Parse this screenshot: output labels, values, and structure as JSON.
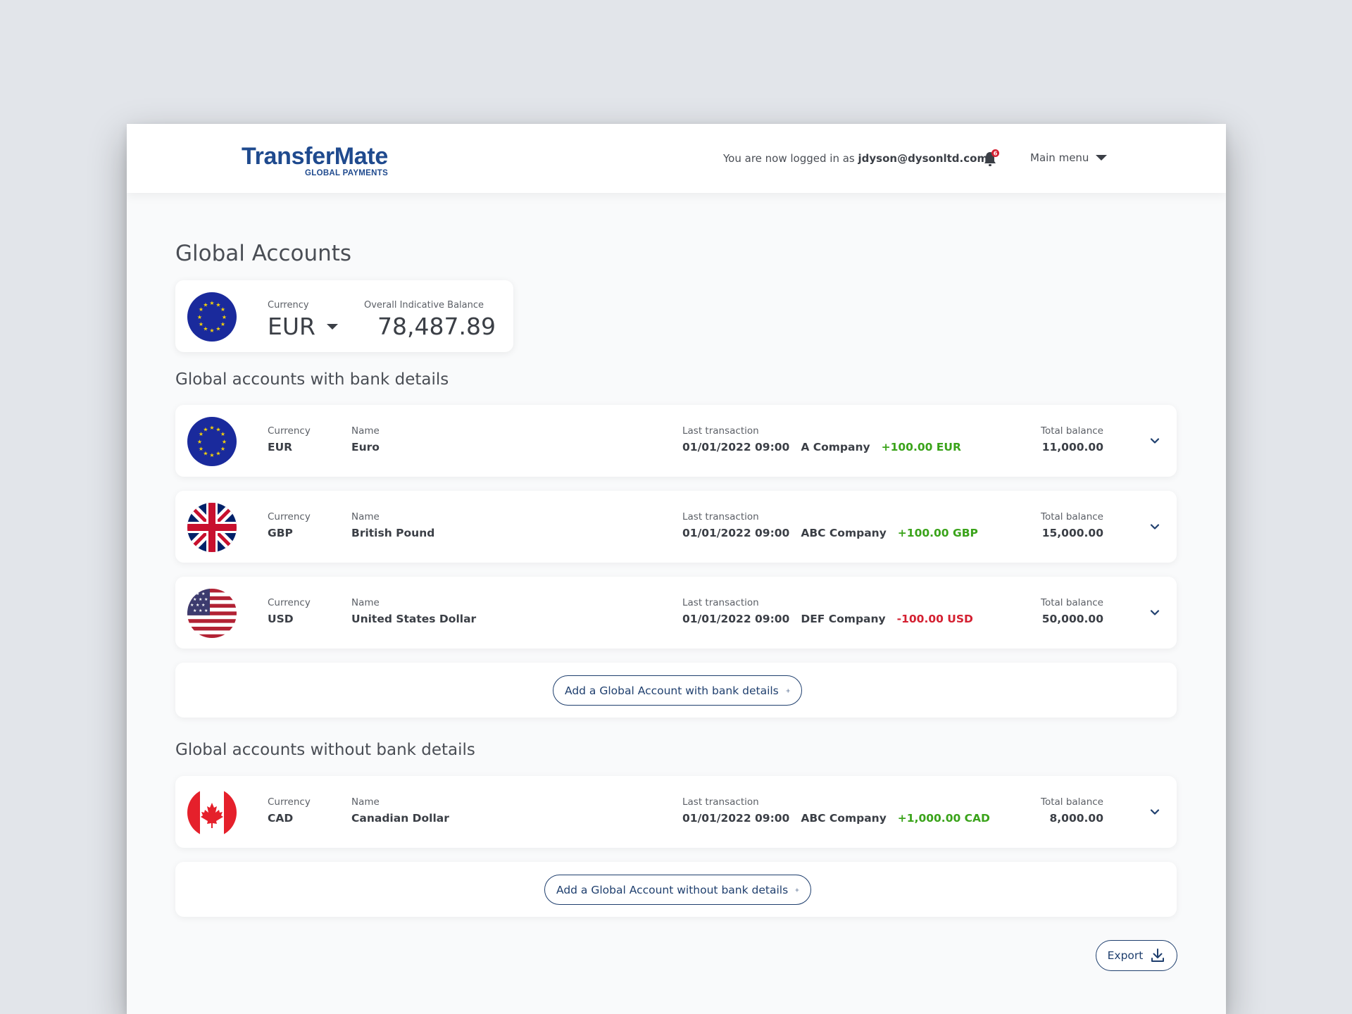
{
  "header": {
    "logo_main": "TransferMate",
    "logo_sub": "GLOBAL PAYMENTS",
    "login_prefix": "You are now logged in as ",
    "login_user": "jdyson@dysonltd.com",
    "notification_count": "6",
    "main_menu_label": "Main menu"
  },
  "page": {
    "title": "Global Accounts"
  },
  "summary": {
    "currency_label": "Currency",
    "currency": "EUR",
    "balance_label": "Overall Indicative Balance",
    "balance": "78,487.89"
  },
  "labels": {
    "currency": "Currency",
    "name": "Name",
    "last_transaction": "Last transaction",
    "total_balance": "Total balance"
  },
  "with_bank": {
    "title": "Global accounts with bank details",
    "accounts": [
      {
        "flag": "eu-flag",
        "currency": "EUR",
        "name": "Euro",
        "last_date": "01/01/2022 09:00",
        "last_party": "A Company",
        "last_amount": "+100.00 EUR",
        "total": "11,000.00"
      },
      {
        "flag": "uk-flag",
        "currency": "GBP",
        "name": "British Pound",
        "last_date": "01/01/2022 09:00",
        "last_party": "ABC Company",
        "last_amount": "+100.00 GBP",
        "total": "15,000.00"
      },
      {
        "flag": "us-flag",
        "currency": "USD",
        "name": "United States Dollar",
        "last_date": "01/01/2022 09:00",
        "last_party": "DEF Company",
        "last_amount": "-100.00 USD",
        "total": "50,000.00"
      }
    ],
    "add_label": "Add a Global Account with bank details"
  },
  "without_bank": {
    "title": "Global accounts without bank details",
    "accounts": [
      {
        "flag": "ca-flag",
        "currency": "CAD",
        "name": "Canadian Dollar",
        "last_date": "01/01/2022 09:00",
        "last_party": "ABC Company",
        "last_amount": "+1,000.00 CAD",
        "total": "8,000.00"
      }
    ],
    "add_label": "Add a Global Account without bank details"
  },
  "export_label": "Export",
  "colors": {
    "brand": "#1f4a8e",
    "positive": "#3aa31a",
    "negative": "#d42031",
    "button_border": "#1f3f6e"
  }
}
